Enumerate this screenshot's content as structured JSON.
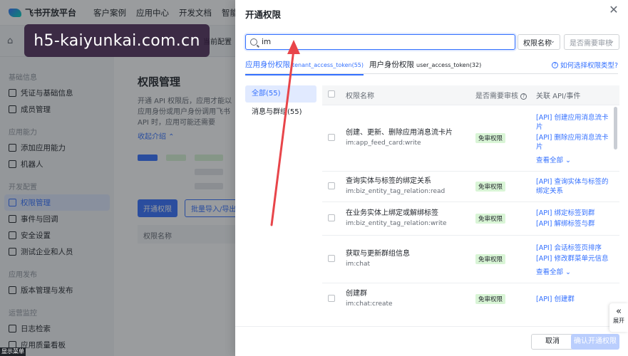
{
  "topbar": {
    "logo": "飞书开放平台",
    "nav": [
      "客户案例",
      "应用中心",
      "开发文档",
      "智能助"
    ]
  },
  "subbar": {
    "app_switch": "当前配置"
  },
  "sidebar": {
    "groups": [
      {
        "title": "基础信息",
        "items": [
          "凭证与基础信息",
          "成员管理"
        ]
      },
      {
        "title": "应用能力",
        "items": [
          "添加应用能力",
          "机器人"
        ]
      },
      {
        "title": "开发配置",
        "items": [
          "权限管理",
          "事件与回调",
          "安全设置",
          "测试企业和人员"
        ]
      },
      {
        "title": "应用发布",
        "items": [
          "版本管理与发布"
        ]
      },
      {
        "title": "运营监控",
        "items": [
          "日志检索",
          "应用质量看板"
        ]
      }
    ],
    "active": "权限管理"
  },
  "content": {
    "title": "权限管理",
    "desc": "开通 API 权限后，应用才能以应用身份或用户身份调用飞书 API 时，应用可能还需要",
    "collapse": "收起介绍",
    "btn_primary": "开通权限",
    "btn_outline": "批量导入/导出权限",
    "table_head": "权限名称"
  },
  "watermark": "h5-kaiyunkai.com.cn",
  "bottom_menu": "显示菜单",
  "drawer": {
    "title": "开通权限",
    "search": {
      "value": "im",
      "placeholder": ""
    },
    "filter_field": "权限名称",
    "filter_audit_placeholder": "是否需要审核",
    "tabs": [
      {
        "label": "应用身份权限",
        "sub": "tenant_access_token(55)"
      },
      {
        "label": "用户身份权限",
        "sub": "user_access_token(32)"
      }
    ],
    "help": "如何选择权限类型?",
    "categories": [
      "全部(55)",
      "消息与群组(55)"
    ],
    "table": {
      "headers": {
        "name": "权限名称",
        "audit": "是否需要审核",
        "api": "关联 API/事件"
      },
      "rows": [
        {
          "name": "创建、更新、删除应用消息流卡片",
          "code": "im:app_feed_card:write",
          "audit": "免审权限",
          "apis": [
            "[API] 创建应用消息流卡片",
            "[API] 删除应用消息流卡片"
          ],
          "more": "查看全部"
        },
        {
          "name": "查询实体与标签的绑定关系",
          "code": "im:biz_entity_tag_relation:read",
          "audit": "免审权限",
          "apis": [
            "[API] 查询实体与标签的绑定关系"
          ],
          "more": ""
        },
        {
          "name": "在业务实体上绑定或解绑标签",
          "code": "im:biz_entity_tag_relation:write",
          "audit": "免审权限",
          "apis": [
            "[API] 绑定标签到群",
            "[API] 解绑标签与群"
          ],
          "more": ""
        },
        {
          "name": "获取与更新群组信息",
          "code": "im:chat",
          "audit": "免审权限",
          "apis": [
            "[API] 会话标签页排序",
            "[API] 修改群菜单元信息"
          ],
          "more": "查看全部"
        },
        {
          "name": "创建群",
          "code": "im:chat:create",
          "audit": "免审权限",
          "apis": [
            "[API] 创建群"
          ],
          "more": ""
        }
      ]
    },
    "footer": {
      "cancel": "取消",
      "confirm": "确认开通权限"
    },
    "expand": "展开"
  },
  "colors": {
    "accent": "#3370ff",
    "badge_bg": "#d9f5d6",
    "arrow": "#e8454a"
  }
}
